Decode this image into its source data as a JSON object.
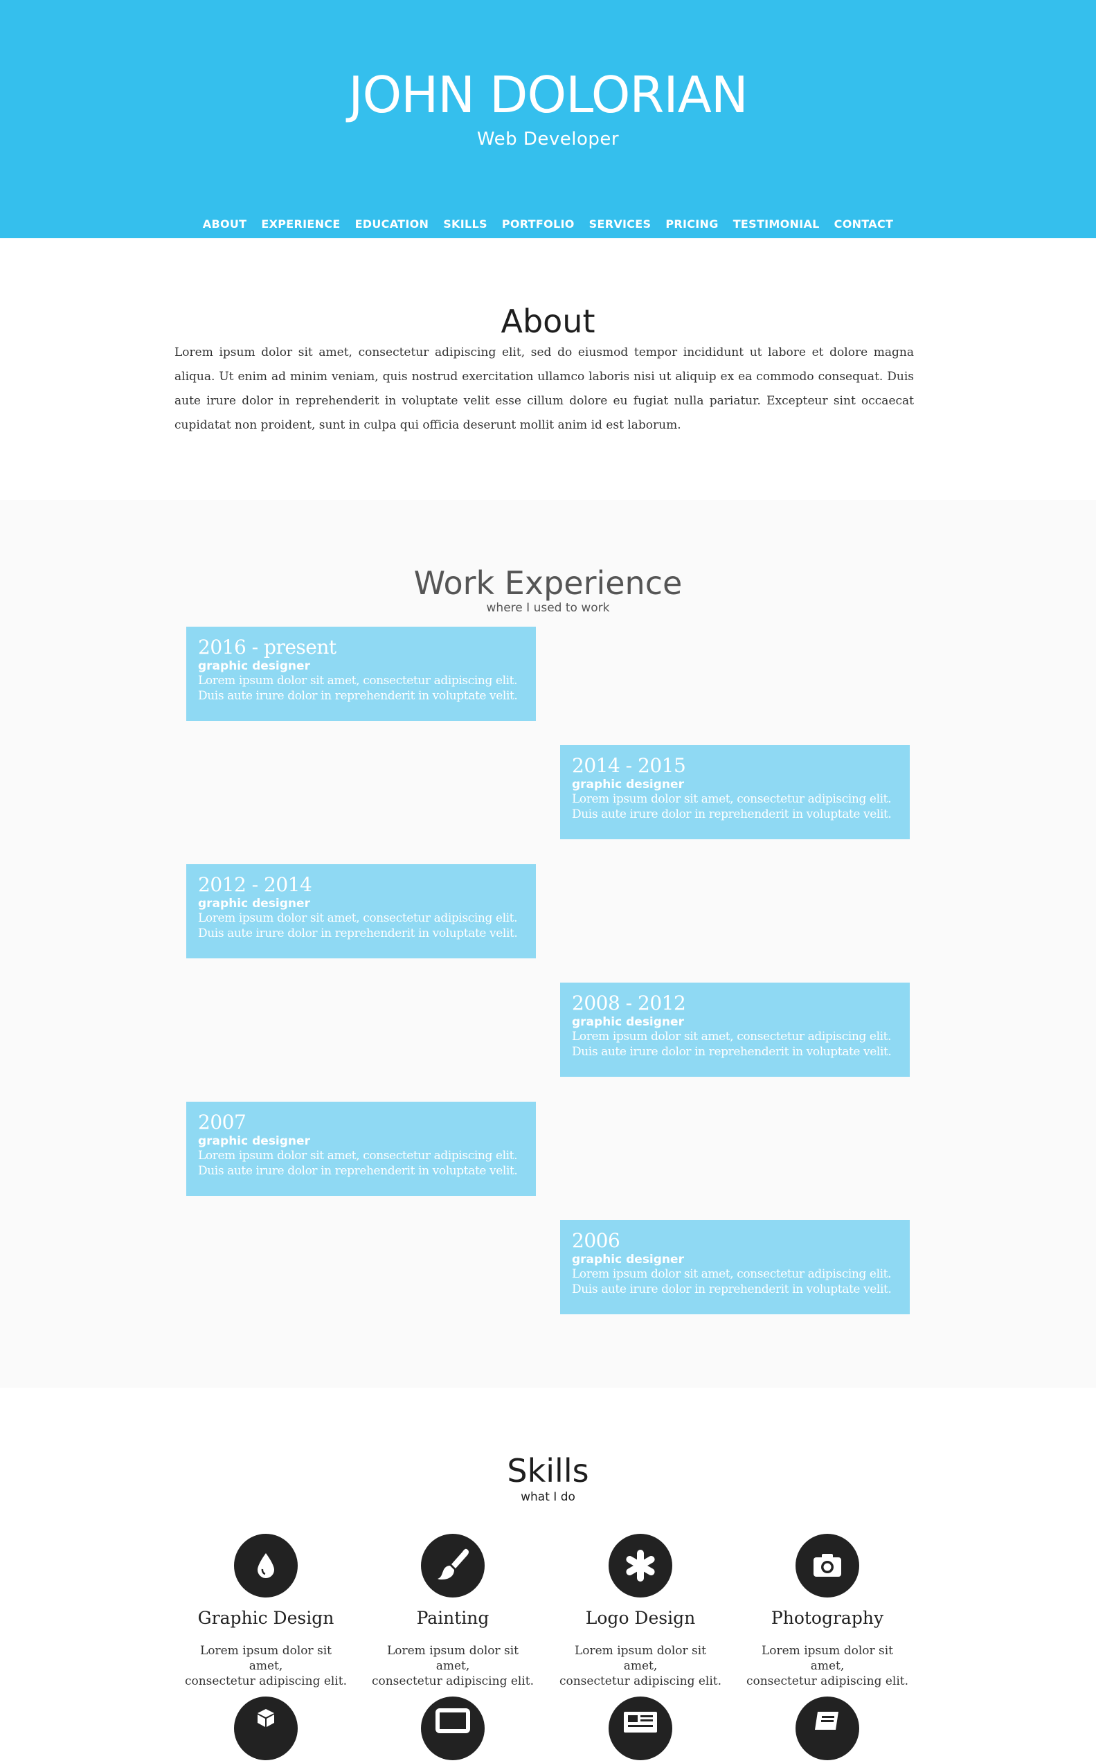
{
  "header": {
    "name": "JOHN DOLORIAN",
    "role": "Web Developer",
    "nav": [
      "ABOUT",
      "EXPERIENCE",
      "EDUCATION",
      "SKILLS",
      "PORTFOLIO",
      "SERVICES",
      "PRICING",
      "TESTIMONIAL",
      "CONTACT"
    ]
  },
  "about": {
    "title": "About",
    "text": "Lorem ipsum dolor sit amet, consectetur adipiscing elit, sed do eiusmod tempor incididunt ut labore et dolore magna aliqua. Ut enim ad minim veniam, quis nostrud exercitation ullamco laboris nisi ut aliquip ex ea commodo consequat. Duis aute irure dolor in reprehenderit in voluptate velit esse cillum dolore eu fugiat nulla pariatur. Excepteur sint occaecat cupidatat non proident, sunt in culpa qui officia deserunt mollit anim id est laborum."
  },
  "experience": {
    "title": "Work Experience",
    "subtitle": "where I used to work",
    "jobs": [
      {
        "years": "2016 - present",
        "title": "graphic designer",
        "line1": "Lorem ipsum dolor sit amet, consectetur adipiscing elit.",
        "line2": "Duis aute irure dolor in reprehenderit in voluptate velit."
      },
      {
        "years": "2014 - 2015",
        "title": "graphic designer",
        "line1": "Lorem ipsum dolor sit amet, consectetur adipiscing elit.",
        "line2": "Duis aute irure dolor in reprehenderit in voluptate velit."
      },
      {
        "years": "2012 - 2014",
        "title": "graphic designer",
        "line1": "Lorem ipsum dolor sit amet, consectetur adipiscing elit.",
        "line2": "Duis aute irure dolor in reprehenderit in voluptate velit."
      },
      {
        "years": "2008 - 2012",
        "title": "graphic designer",
        "line1": "Lorem ipsum dolor sit amet, consectetur adipiscing elit.",
        "line2": "Duis aute irure dolor in reprehenderit in voluptate velit."
      },
      {
        "years": "2007",
        "title": "graphic designer",
        "line1": "Lorem ipsum dolor sit amet, consectetur adipiscing elit.",
        "line2": "Duis aute irure dolor in reprehenderit in voluptate velit."
      },
      {
        "years": "2006",
        "title": "graphic designer",
        "line1": "Lorem ipsum dolor sit amet, consectetur adipiscing elit.",
        "line2": "Duis aute irure dolor in reprehenderit in voluptate velit."
      }
    ]
  },
  "skills": {
    "title": "Skills",
    "subtitle": "what I do",
    "items": [
      {
        "name": "Graphic Design",
        "icon": "drop-icon",
        "line1": "Lorem ipsum dolor sit amet,",
        "line2": "consectetur adipiscing elit."
      },
      {
        "name": "Painting",
        "icon": "paintbrush-icon",
        "line1": "Lorem ipsum dolor sit amet,",
        "line2": "consectetur adipiscing elit."
      },
      {
        "name": "Logo Design",
        "icon": "asterisk-icon",
        "line1": "Lorem ipsum dolor sit amet,",
        "line2": "consectetur adipiscing elit."
      },
      {
        "name": "Photography",
        "icon": "camera-icon",
        "line1": "Lorem ipsum dolor sit amet,",
        "line2": "consectetur adipiscing elit."
      }
    ],
    "more_icons": [
      "cubes-icon",
      "monitor-icon",
      "newspaper-icon",
      "book-icon"
    ]
  },
  "colors": {
    "header_bg": "#35bfed",
    "job_bg": "#8fd9f3",
    "icon_circle": "#222222"
  }
}
